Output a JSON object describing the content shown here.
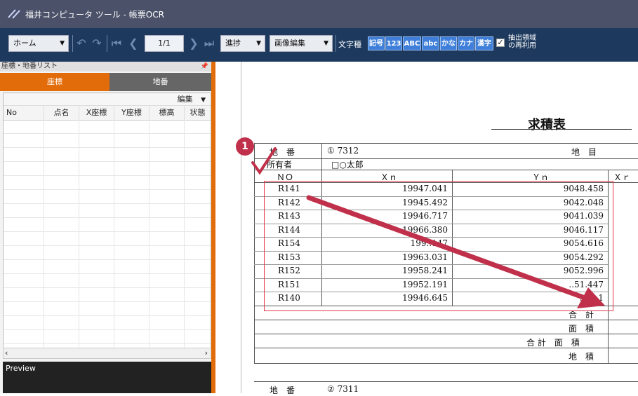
{
  "window": {
    "title": "福井コンピュータ ツール - 帳票OCR"
  },
  "toolbar": {
    "home_label": "ホーム",
    "page_display": "1/1",
    "progress_label": "進捗",
    "image_edit_label": "画像編集",
    "char_type_label": "文字種",
    "char_types": [
      "記号",
      "123",
      "ABC",
      "abc",
      "かな",
      "カナ",
      "漢字"
    ],
    "reuse_checked": true,
    "reuse_label_1": "抽出領域",
    "reuse_label_2": "の再利用"
  },
  "panel": {
    "title": "座標・地番リスト",
    "pin": "ㅁ",
    "tabs": [
      {
        "label": "座標",
        "active": true
      },
      {
        "label": "地番",
        "active": false
      }
    ],
    "edit_label": "編集",
    "columns": [
      "No",
      "点名",
      "X座標",
      "Y座標",
      "標高",
      "状態"
    ],
    "preview_label": "Preview"
  },
  "document": {
    "title": "求積表",
    "row_label_parcel": "地　番",
    "parcel_value": "① 7312",
    "right_label_top": "地　目",
    "row_label_owner": "所有者",
    "owner_value": "□○太郎",
    "col_no": "ＮＯ",
    "col_xn": "Ｘｎ",
    "col_yn": "Ｙｎ",
    "col_xr": "Ｘｒ",
    "rows": [
      {
        "no": "R141",
        "xn": "19947.041",
        "yn": "9048.458"
      },
      {
        "no": "R142",
        "xn": "19945.492",
        "yn": "9042.048"
      },
      {
        "no": "R143",
        "xn": "19946.717",
        "yn": "9041.039"
      },
      {
        "no": "R144",
        "xn": "19966.380",
        "yn": "9046.117"
      },
      {
        "no": "R154",
        "xn": "199..147",
        "yn": "9054.616"
      },
      {
        "no": "R153",
        "xn": "19963.031",
        "yn": "9054.292"
      },
      {
        "no": "R152",
        "xn": "19958.241",
        "yn": "9052.996"
      },
      {
        "no": "R151",
        "xn": "19952.191",
        "yn": "..51.447"
      },
      {
        "no": "R140",
        "xn": "19946.645",
        "yn": "90...1"
      }
    ],
    "summary_1": "合　計",
    "summary_2": "面　積",
    "summary_3": "合 計　面　積",
    "summary_4": "地　積",
    "next_section_label": "地　番",
    "next_section_value": "② 7311"
  },
  "annotation": {
    "badge_number": "1",
    "highlight_color": "#e0374a",
    "arrow_color": "#c0304a"
  }
}
